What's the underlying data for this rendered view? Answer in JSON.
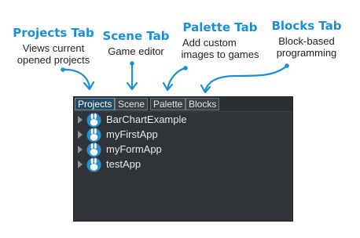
{
  "callouts": {
    "projects": {
      "title": "Projects Tab",
      "line1": "Views current",
      "line2": "opened projects"
    },
    "scene": {
      "title": "Scene Tab",
      "line1": "Game editor"
    },
    "palette": {
      "title": "Palette Tab",
      "line1": "Add custom",
      "line2": "images to games"
    },
    "blocks": {
      "title": "Blocks Tab",
      "line1": "Block-based",
      "line2": "programming"
    }
  },
  "colors": {
    "accent": "#1a8fd6",
    "panel_bg": "#2f3438",
    "active_tab": "#204c69"
  },
  "tabs": [
    {
      "label": "Projects",
      "active": true
    },
    {
      "label": "Scene",
      "active": false
    },
    {
      "label": "Palette",
      "active": false
    },
    {
      "label": "Blocks",
      "active": false
    }
  ],
  "projects": [
    {
      "name": "BarChartExample",
      "icon": "app-bunny-icon"
    },
    {
      "name": "myFirstApp",
      "icon": "app-bunny-icon"
    },
    {
      "name": "myFormApp",
      "icon": "app-bunny-icon"
    },
    {
      "name": "testApp",
      "icon": "app-bunny-icon"
    }
  ]
}
